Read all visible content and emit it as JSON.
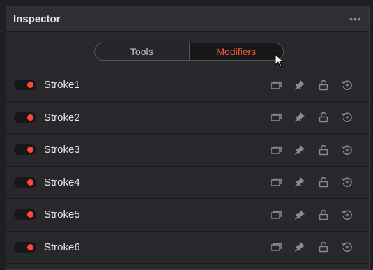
{
  "header": {
    "title": "Inspector",
    "more_label": "•••"
  },
  "tabs": [
    {
      "label": "Tools",
      "active": false
    },
    {
      "label": "Modifiers",
      "active": true
    }
  ],
  "rows": [
    {
      "label": "Stroke1",
      "enabled": true
    },
    {
      "label": "Stroke2",
      "enabled": true
    },
    {
      "label": "Stroke3",
      "enabled": true
    },
    {
      "label": "Stroke4",
      "enabled": true
    },
    {
      "label": "Stroke5",
      "enabled": true
    },
    {
      "label": "Stroke6",
      "enabled": true
    }
  ],
  "row_icons": [
    "collapse-icon",
    "pin-icon",
    "lock-icon",
    "reset-icon"
  ],
  "colors": {
    "accent": "#ff5a3c",
    "toggle_dot": "#ff4a2a",
    "panel_bg": "#28282c"
  }
}
